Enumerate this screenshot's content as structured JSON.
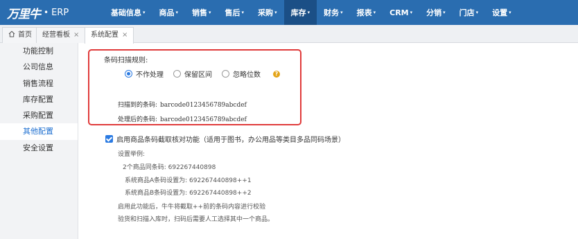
{
  "app": {
    "logo_mark": "万里牛",
    "logo_dot": "•",
    "logo_suffix": "ERP"
  },
  "nav": {
    "items": [
      {
        "label": "基础信息",
        "active": false
      },
      {
        "label": "商品",
        "active": false
      },
      {
        "label": "销售",
        "active": false
      },
      {
        "label": "售后",
        "active": false
      },
      {
        "label": "采购",
        "active": false
      },
      {
        "label": "库存",
        "active": true
      },
      {
        "label": "财务",
        "active": false
      },
      {
        "label": "报表",
        "active": false
      },
      {
        "label": "CRM",
        "active": false
      },
      {
        "label": "分销",
        "active": false
      },
      {
        "label": "门店",
        "active": false
      },
      {
        "label": "设置",
        "active": false
      }
    ],
    "caret": "▾"
  },
  "tabs": [
    {
      "label": "首页",
      "icon": "home-icon",
      "closable": false
    },
    {
      "label": "经营看板",
      "closable": true
    },
    {
      "label": "系统配置",
      "closable": true,
      "active": true
    }
  ],
  "tab_close": "×",
  "sidebar": {
    "items": [
      {
        "label": "功能控制"
      },
      {
        "label": "公司信息"
      },
      {
        "label": "销售流程"
      },
      {
        "label": "库存配置"
      },
      {
        "label": "采购配置"
      },
      {
        "label": "其他配置",
        "active": true
      },
      {
        "label": "安全设置"
      }
    ]
  },
  "barcode_rule": {
    "title": "条码扫描规则:",
    "options": [
      {
        "label": "不作处理",
        "selected": true
      },
      {
        "label": "保留区间",
        "selected": false
      },
      {
        "label": "忽略位数",
        "selected": false
      }
    ],
    "help": "?",
    "scanned_label": "扫描到的条码:",
    "scanned_value": "barcode0123456789abcdef",
    "processed_label": "处理后的条码:",
    "processed_value": "barcode0123456789abcdef"
  },
  "intercept": {
    "checked": true,
    "label": "启用商品条码截取核对功能（适用于图书，办公用品等类目多品同码场景）",
    "example_title": "设置举例:",
    "lines": [
      "2个商品同条码: 692267440898",
      "系统商品A条码设置为: 692267440898++1",
      "系统商品B条码设置为: 692267440898++2"
    ],
    "note1": "启用此功能后，牛牛将截取++前的条码内容进行校验",
    "note2": "验货和扫描入库时，扫码后需要人工选择其中一个商品。"
  },
  "colors": {
    "nav_bg": "#2a6db0",
    "nav_active": "#1b4f86",
    "highlight_border": "#e03a3a",
    "accent": "#2a7ae2"
  }
}
